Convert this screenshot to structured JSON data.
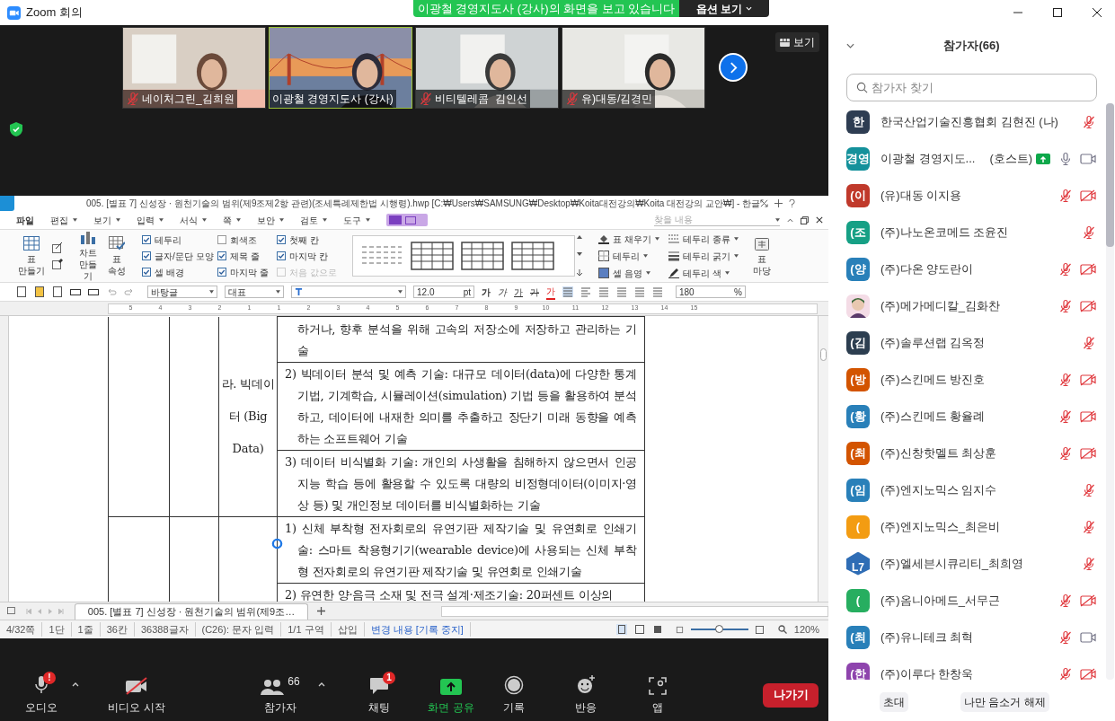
{
  "window": {
    "title": "Zoom 회의"
  },
  "share_banner": {
    "text": "이광철 경영지도사 (강사)의 화면을 보고 있습니다",
    "options": "옵션 보기"
  },
  "thumbnails": [
    {
      "name": "네이처그린_김희원",
      "muted": true,
      "selected": false
    },
    {
      "name": "이광철 경영지도사 (강사)",
      "muted": false,
      "selected": true
    },
    {
      "name": "비티텔레콤  김인선",
      "muted": true,
      "selected": false
    },
    {
      "name": "유)대동/김경민",
      "muted": true,
      "selected": false
    }
  ],
  "view_button": "보기",
  "hwp": {
    "title": "005. [별표 7] 신성장 · 원천기술의 범위(제9조제2항 관련)(조세특례제한법 시행령).hwp [C:₩Users₩SAMSUNG₩Desktop₩Koita대전강의₩Koita 대전강의 교안₩] - 한글",
    "menus": [
      {
        "label": "파일",
        "dropdown": false
      },
      {
        "label": "편집",
        "dropdown": true
      },
      {
        "label": "보기",
        "dropdown": true
      },
      {
        "label": "입력",
        "dropdown": true
      },
      {
        "label": "서식",
        "dropdown": true
      },
      {
        "label": "쪽",
        "dropdown": true
      },
      {
        "label": "보안",
        "dropdown": true
      },
      {
        "label": "검토",
        "dropdown": true
      },
      {
        "label": "도구",
        "dropdown": true
      }
    ],
    "find_placeholder": "찾을 내용",
    "ribbon": {
      "make_table": [
        "표",
        "만들기"
      ],
      "chart": [
        "차트",
        "만들기"
      ],
      "table_props": [
        "표",
        "속성"
      ],
      "checkboxes": [
        [
          {
            "label": "테두리",
            "checked": true
          },
          {
            "label": "글자/문단 모양",
            "checked": true
          },
          {
            "label": "셀 배경",
            "checked": true
          }
        ],
        [
          {
            "label": "회색조",
            "checked": false
          },
          {
            "label": "제목 줄",
            "checked": true
          },
          {
            "label": "마지막 줄",
            "checked": true
          }
        ],
        [
          {
            "label": "첫째 칸",
            "checked": true
          },
          {
            "label": "마지막 칸",
            "checked": true
          }
        ]
      ],
      "reset": {
        "label": "처음 값으로",
        "disabled": true
      },
      "tools": [
        {
          "label": "표 채우기",
          "kind": "fill"
        },
        {
          "label": "테두리",
          "kind": "border"
        },
        {
          "label": "셀 음영",
          "kind": "shade"
        },
        {
          "label": "테두리 종류",
          "kind": "style"
        },
        {
          "label": "테두리 굵기",
          "kind": "weight"
        },
        {
          "label": "테두리 색",
          "kind": "color"
        }
      ],
      "table_gallery": [
        "표",
        "마당"
      ]
    },
    "format": {
      "style": "바탕글",
      "lang": "대표",
      "size": "12.0",
      "unit": "pt",
      "char_buttons": [
        {
          "label": "가",
          "kind": "bold"
        },
        {
          "label": "가",
          "kind": "italic"
        },
        {
          "label": "가",
          "kind": "underline"
        },
        {
          "label": "가",
          "kind": "strike"
        },
        {
          "label": "가",
          "kind": "color"
        }
      ],
      "zoom": "180",
      "zoom_unit": "%"
    },
    "ruler": [
      "5",
      "4",
      "3",
      "2",
      "1",
      "1",
      "2",
      "3",
      "4",
      "5",
      "6",
      "7",
      "8",
      "9",
      "10",
      "11",
      "12",
      "13",
      "14",
      "15"
    ],
    "table": {
      "label": "라. 빅데이터 (Big Data)",
      "rows": [
        {
          "text": "하거나, 향후 분석을 위해 고속의 저장소에 저장하고 관리하는 기술",
          "continued": true
        },
        {
          "text": "2) 빅데이터 분석 및 예측 기술: 대규모 데이터(data)에 다양한 통계기법, 기계학습, 시뮬레이션(simulation) 기법 등을 활용하여 분석하고, 데이터에 내재한 의미를 추출하고 장단기 미래 동향을 예측하는 소프트웨어 기술",
          "continued": false
        },
        {
          "text": "3) 데이터 비식별화 기술: 개인의 사생활을 침해하지 않으면서 인공지능 학습 등에 활용할 수 있도록 대량의 비정형데이터(이미지·영상 등) 및 개인정보 데이터를 비식별화하는 기술",
          "continued": false
        },
        {
          "text": "1) 신체 부착형 전자회로의 유연기판 제작기술 및 유연회로 인쇄기술: 스마트 착용형기기(wearable device)에 사용되는 신체 부착형 전자회로의 유연기판 제작기술 및 유연회로 인쇄기술",
          "continued": false
        },
        {
          "text": "2) 유연한 양·음극 소재 및 전극 설계·제조기술: 20퍼센트 이상의",
          "continued": false
        }
      ]
    },
    "doc_tab": "005. [별표 7] 신성장 · 원천기술의 범위(제9조…",
    "status": [
      {
        "text": "4/32쪽",
        "kind": "plain"
      },
      {
        "text": "1단",
        "kind": "plain"
      },
      {
        "text": "1줄",
        "kind": "plain"
      },
      {
        "text": "36칸",
        "kind": "plain"
      },
      {
        "text": "36388글자",
        "kind": "plain"
      },
      {
        "text": "(C26): 문자 입력",
        "kind": "plain"
      },
      {
        "text": "1/1 구역",
        "kind": "plain"
      },
      {
        "text": "삽입",
        "kind": "plain"
      },
      {
        "text": "변경 내용 [기록 중지]",
        "kind": "link"
      }
    ],
    "zoom_slider": {
      "level": 0.48,
      "reading": "120%"
    }
  },
  "toolbar": [
    {
      "label": "오디오",
      "kind": "audio",
      "badge": "!"
    },
    {
      "label": "비디오 시작",
      "kind": "video"
    },
    {
      "label": "참가자",
      "kind": "participants",
      "count": "66"
    },
    {
      "label": "채팅",
      "kind": "chat",
      "badge": "1"
    },
    {
      "label": "화면 공유",
      "kind": "share"
    },
    {
      "label": "기록",
      "kind": "record"
    },
    {
      "label": "반응",
      "kind": "reaction"
    },
    {
      "label": "앱",
      "kind": "apps"
    }
  ],
  "leave": "나가기",
  "panel": {
    "title": "참가자(66)",
    "search_placeholder": "참가자 찾기",
    "participants": [
      {
        "avatar": "한",
        "kind": "initials",
        "color": "#2e3d52",
        "name": "한국산업기술진흥협회 김현진 (나)",
        "muted": true
      },
      {
        "avatar": "경영",
        "kind": "initials",
        "color": "#14919b",
        "name": "이광철 경영지도...",
        "role": "(호스트)",
        "sharing": true,
        "muted": false,
        "video_off": false
      },
      {
        "avatar": "(이",
        "kind": "initials",
        "color": "#c0392b",
        "name": "(유)대동 이지용",
        "muted": true,
        "video_off": true
      },
      {
        "avatar": "(조",
        "kind": "initials",
        "color": "#16a085",
        "name": "(주)나노온코메드 조윤진",
        "muted": true
      },
      {
        "avatar": "(양",
        "kind": "initials",
        "color": "#2980b9",
        "name": "(주)다온 양도란이",
        "muted": true,
        "video_off": true
      },
      {
        "kind": "picture",
        "name": "(주)메가메디칼_김화찬",
        "muted": true,
        "video_off": true
      },
      {
        "avatar": "(김",
        "kind": "initials",
        "color": "#2c3e50",
        "name": "(주)솔루션랩 김옥정",
        "muted": true
      },
      {
        "avatar": "(방",
        "kind": "initials",
        "color": "#d35400",
        "name": "(주)스킨메드 방진호",
        "muted": true,
        "video_off": true
      },
      {
        "avatar": "(황",
        "kind": "initials",
        "color": "#2980b9",
        "name": "(주)스킨메드 황율례",
        "muted": true,
        "video_off": true
      },
      {
        "avatar": "(최",
        "kind": "initials",
        "color": "#d35400",
        "name": "(주)신창핫멜트 최상훈",
        "muted": true,
        "video_off": true
      },
      {
        "avatar": "(임",
        "kind": "initials",
        "color": "#2980b9",
        "name": "(주)엔지노믹스 임지수",
        "muted": true
      },
      {
        "avatar": "(",
        "kind": "initials",
        "color": "#f39c12",
        "name": "(주)엔지노믹스_최은비",
        "muted": true
      },
      {
        "avatar": "L7",
        "kind": "logo",
        "name": "(주)엘세븐시큐리티_최희영",
        "muted": true
      },
      {
        "avatar": "(",
        "kind": "initials",
        "color": "#27ae60",
        "name": "(주)옴니아메드_서무근",
        "muted": true,
        "video_off": true
      },
      {
        "avatar": "(최",
        "kind": "initials",
        "color": "#2980b9",
        "name": "(주)유니테크 최혁",
        "muted": true,
        "video_off": false
      },
      {
        "avatar": "(한",
        "kind": "initials",
        "color": "#8e44ad",
        "name": "(주)이루다 한창욱",
        "muted": true,
        "video_off": true
      }
    ],
    "buttons": [
      "초대",
      "나만 음소거 해제"
    ]
  }
}
